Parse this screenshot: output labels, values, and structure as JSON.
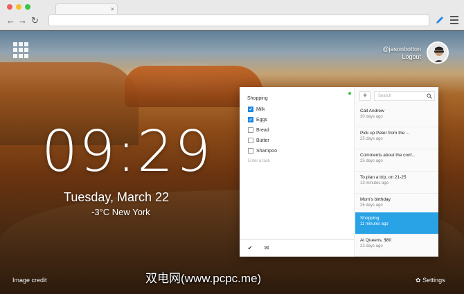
{
  "browser": {
    "back": "←",
    "forward": "→",
    "reload": "↻",
    "tab_close": "×"
  },
  "user": {
    "handle": "@jasonbotton",
    "logout": "Logout"
  },
  "clock": {
    "time": "09:29"
  },
  "date": {
    "text": "Tuesday, March 22"
  },
  "weather": {
    "text": "-3°C  New York"
  },
  "todo": {
    "list_title": "Shopping",
    "tasks": [
      {
        "label": "Milk",
        "done": true
      },
      {
        "label": "Eggs",
        "done": true
      },
      {
        "label": "Bread",
        "done": false
      },
      {
        "label": "Butter",
        "done": false
      },
      {
        "label": "Shampoo",
        "done": false
      }
    ],
    "input_placeholder": "Enter a task",
    "check_glyph": "✔",
    "mail_glyph": "✉"
  },
  "notes": {
    "add": "+",
    "search_placeholder": "Search",
    "items": [
      {
        "title": "Call Andrew",
        "time": "30 days ago"
      },
      {
        "title": "Pick up Peter from the ...",
        "time": "25 days ago"
      },
      {
        "title": "Comments about the conf...",
        "time": "25 days ago"
      },
      {
        "title": "To plan a trip, on 21-25",
        "time": "13 minutes ago"
      },
      {
        "title": "Mom's birthday",
        "time": "25 days ago"
      },
      {
        "title": "Shopping",
        "time": "11 minutes ago"
      },
      {
        "title": "At Queens, $60",
        "time": "23 days ago"
      }
    ],
    "active_index": 5
  },
  "footer": {
    "image_credit": "Image credit",
    "settings": "Settings",
    "settings_glyph": "✿"
  },
  "watermark": "双电网(www.pcpc.me)",
  "colors": {
    "accent": "#29a3e6",
    "checkbox": "#1e88e5"
  }
}
